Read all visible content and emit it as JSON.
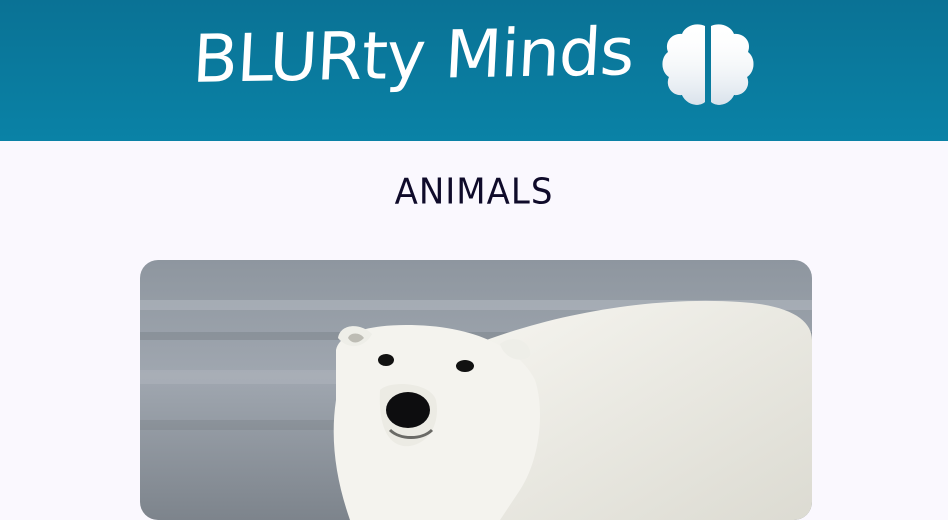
{
  "header": {
    "site_title": "BLURty Minds",
    "logo_icon": "brain-icon",
    "background": "#0a7a9e"
  },
  "main": {
    "section_title": "ANIMALS",
    "photo": {
      "subject": "polar-bear",
      "icon": "polar-bear-photo"
    }
  }
}
